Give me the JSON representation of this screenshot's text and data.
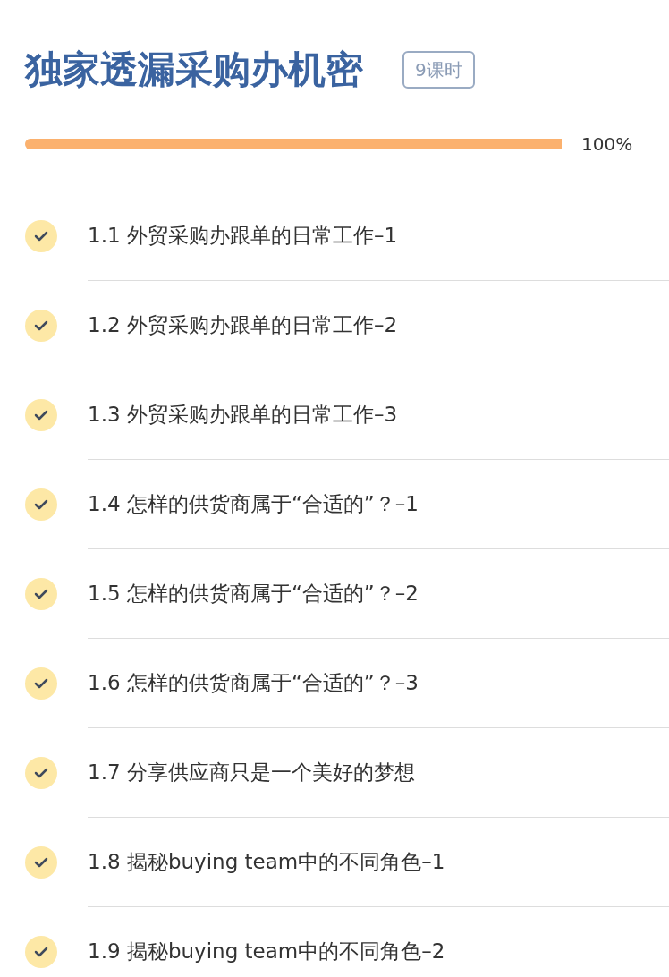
{
  "course": {
    "title": "独家透漏采购办机密",
    "lesson_count": "9课时"
  },
  "progress": {
    "level": 1,
    "reading": "100%"
  },
  "lessons": [
    {
      "title": "1.1 外贸采购办跟单的日常工作–1",
      "completed": true
    },
    {
      "title": "1.2 外贸采购办跟单的日常工作–2",
      "completed": true
    },
    {
      "title": "1.3 外贸采购办跟单的日常工作–3",
      "completed": true
    },
    {
      "title": "1.4 怎样的供货商属于“合适的”？–1",
      "completed": true
    },
    {
      "title": "1.5 怎样的供货商属于“合适的”？–2",
      "completed": true
    },
    {
      "title": "1.6 怎样的供货商属于“合适的”？–3",
      "completed": true
    },
    {
      "title": "1.7 分享供应商只是一个美好的梦想",
      "completed": true
    },
    {
      "title": "1.8 揭秘buying team中的不同角色–1",
      "completed": true
    },
    {
      "title": "1.9 揭秘buying team中的不同角色–2",
      "completed": true
    }
  ]
}
